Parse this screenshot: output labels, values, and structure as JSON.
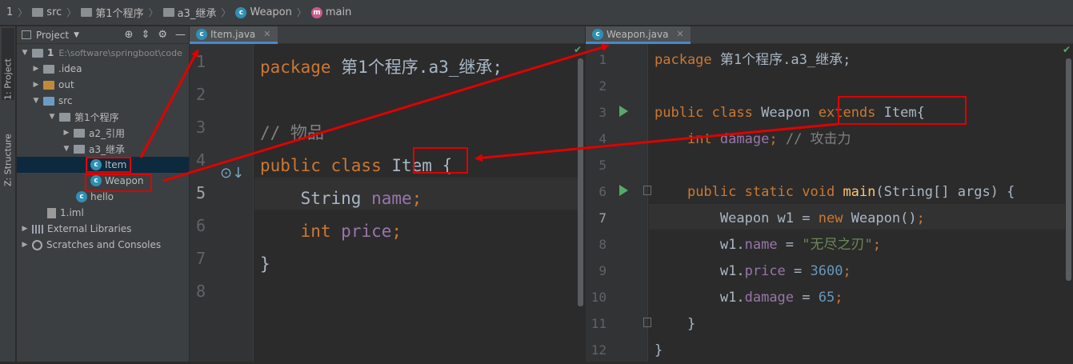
{
  "breadcrumb": {
    "items": [
      "1",
      "src",
      "第1个程序",
      "a3_继承",
      "Weapon",
      "main"
    ]
  },
  "side_tabs": {
    "project": "1: Project",
    "structure": "Z: Structure"
  },
  "project_panel": {
    "title": "Project",
    "tree": [
      {
        "label": "1",
        "path": "E:\\software\\springboot\\code"
      },
      {
        "label": ".idea"
      },
      {
        "label": "out"
      },
      {
        "label": "src"
      },
      {
        "label": "第1个程序"
      },
      {
        "label": "a2_引用"
      },
      {
        "label": "a3_继承"
      },
      {
        "label": "Item"
      },
      {
        "label": "Weapon"
      },
      {
        "label": "hello"
      },
      {
        "label": "1.iml"
      },
      {
        "label": "External Libraries"
      },
      {
        "label": "Scratches and Consoles"
      }
    ]
  },
  "left_editor": {
    "tab_label": "Item.java",
    "line_numbers": [
      "1",
      "2",
      "3",
      "4",
      "5",
      "6",
      "7",
      "8"
    ],
    "code": {
      "l1_kw": "package",
      "l1_rest": " 第1个程序.a3_继承;",
      "l3": "// 物品",
      "l4_kw": "public class",
      "l4_name": "Item",
      "l4_rest": "{",
      "l5_type": "String",
      "l5_field": "name",
      "l5_end": ";",
      "l6_type": "int",
      "l6_field": "price",
      "l6_end": ";",
      "l7": "}"
    }
  },
  "right_editor": {
    "tab_label": "Weapon.java",
    "line_numbers": [
      "1",
      "2",
      "3",
      "4",
      "5",
      "6",
      "7",
      "8",
      "9",
      "10",
      "11",
      "12"
    ],
    "code": {
      "l1_kw": "package",
      "l1_rest": " 第1个程序.a3_继承;",
      "l3_kw": "public class",
      "l3_name": "Weapon",
      "l3_ext": "extends",
      "l3_super": "Item",
      "l3_brace": "{",
      "l4_type": "int",
      "l4_field": "damage",
      "l4_semi": ";",
      "l4_cmt": "// 攻击力",
      "l6_kw": "public static void",
      "l6_fn": "main",
      "l6_rest": "(String[] args) {",
      "l7_a": "Weapon w1 = ",
      "l7_new": "new",
      "l7_b": " Weapon()",
      "l7_semi": ";",
      "l8_a": "w1.",
      "l8_field": "name",
      "l8_eq": " = ",
      "l8_str": "\"无尽之刃\"",
      "l8_semi": ";",
      "l9_a": "w1.",
      "l9_field": "price",
      "l9_eq": " = ",
      "l9_num": "3600",
      "l9_semi": ";",
      "l10_a": "w1.",
      "l10_field": "damage",
      "l10_eq": " = ",
      "l10_num": "65",
      "l10_semi": ";",
      "l11": "}",
      "l12": "}"
    }
  },
  "colors": {
    "annotation": "#e00000",
    "keyword": "#cc7832",
    "field": "#9876aa",
    "string": "#6a8759",
    "number": "#6897bb"
  }
}
